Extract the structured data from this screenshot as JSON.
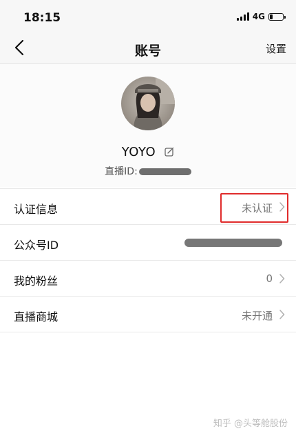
{
  "status_bar": {
    "time": "18:15",
    "network": "4G",
    "battery_level": 0.25
  },
  "nav": {
    "back_icon": "chevron-left-icon",
    "title": "账号",
    "settings_label": "设置"
  },
  "profile": {
    "avatar_icon": "user-avatar-photo",
    "name": "YOYO",
    "edit_icon": "edit-icon",
    "live_id_label": "直播ID:"
  },
  "rows": [
    {
      "label": "认证信息",
      "value": "未认证",
      "has_chevron": true
    },
    {
      "label": "公众号ID",
      "value": "",
      "has_chevron": false
    },
    {
      "label": "我的粉丝",
      "value": "0",
      "has_chevron": true
    },
    {
      "label": "直播商城",
      "value": "未开通",
      "has_chevron": true
    }
  ],
  "highlight_color": "#e02b2b",
  "watermark": "知乎 @头等舱股份"
}
